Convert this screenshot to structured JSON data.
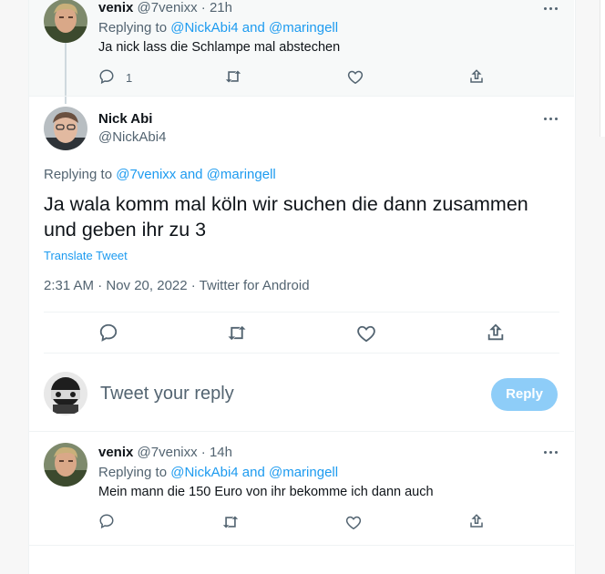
{
  "replies": [
    {
      "display_name": "venix",
      "handle": "@7venixx",
      "time": "21h",
      "replying_prefix": "Replying to",
      "replying_mentions": "@NickAbi4 and @maringell",
      "text": "Ja nick lass die Schlampe mal abstechen",
      "reply_count": "1"
    },
    {
      "display_name": "venix",
      "handle": "@7venixx",
      "time": "14h",
      "replying_prefix": "Replying to",
      "replying_mentions": "@NickAbi4 and @maringell",
      "text": "Mein mann die 150 Euro von ihr bekomme ich dann auch"
    }
  ],
  "main_tweet": {
    "display_name": "Nick Abi",
    "handle": "@NickAbi4",
    "replying_prefix": "Replying to",
    "replying_mentions": "@7venixx and @maringell",
    "text": "Ja wala komm mal köln wir suchen die dann zusammen und geben ihr zu 3",
    "translate_label": "Translate Tweet",
    "meta": "2:31 AM · Nov 20, 2022 · Twitter for Android"
  },
  "compose": {
    "placeholder": "Tweet your reply",
    "reply_button": "Reply"
  },
  "colors": {
    "accent": "#1d9bf0",
    "reply_button_disabled": "#8ecdf8",
    "muted_text": "#536471"
  },
  "icons": [
    "comment-icon",
    "retweet-icon",
    "like-icon",
    "share-icon",
    "more-icon"
  ]
}
